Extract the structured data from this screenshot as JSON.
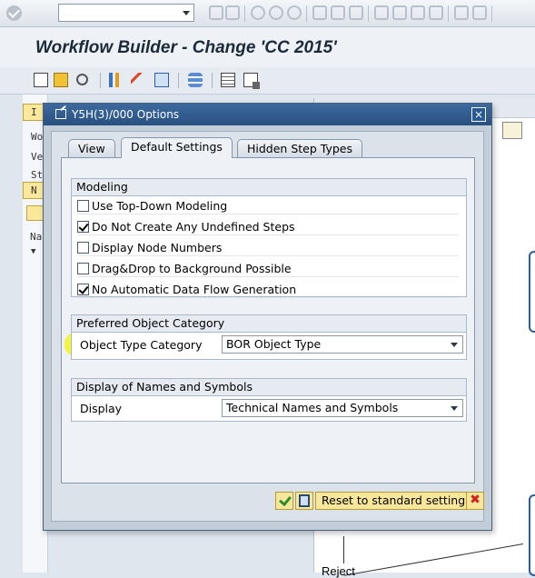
{
  "app": {
    "title": "Workflow Builder - Change 'CC 2015'"
  },
  "background": {
    "left_texts": [
      "Wo",
      "Ve",
      "St"
    ],
    "nav_label": "Nav",
    "tab_i": "I",
    "tab_n": "N",
    "reject_label": "Reject"
  },
  "dialog": {
    "title": "Y5H(3)/000 Options",
    "close_label": "×",
    "tabs": [
      {
        "label": "View",
        "active": false
      },
      {
        "label": "Default Settings",
        "active": true
      },
      {
        "label": "Hidden Step Types",
        "active": false
      }
    ],
    "modeling": {
      "heading": "Modeling",
      "options": [
        {
          "label": "Use Top-Down Modeling",
          "checked": false
        },
        {
          "label": "Do Not Create Any Undefined Steps",
          "checked": true
        },
        {
          "label": "Display Node Numbers",
          "checked": false
        },
        {
          "label": "Drag&Drop to Background Possible",
          "checked": false
        },
        {
          "label": "No Automatic Data Flow Generation",
          "checked": true
        }
      ]
    },
    "preferred_category": {
      "heading": "Preferred Object Category",
      "field_label": "Object Type Category",
      "value": "BOR Object Type"
    },
    "names_symbols": {
      "heading": "Display of Names and Symbols",
      "field_label": "Display",
      "value": "Technical Names and Symbols"
    },
    "footer": {
      "reset_label": "Reset to standard setting",
      "cancel_glyph": "✖"
    }
  },
  "colors": {
    "dialog_title_bar": "#28507f",
    "highlight": "#f2f51d",
    "button_yellow": "#f8e79a"
  }
}
